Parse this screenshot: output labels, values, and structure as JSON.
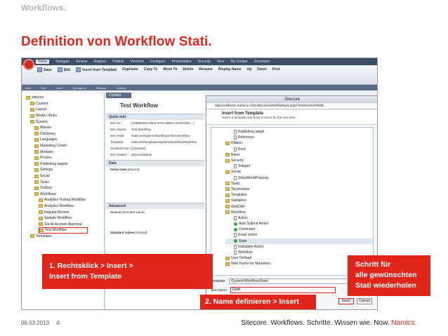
{
  "slide": {
    "header": "Workflows.",
    "title": "Definition von Workflow Stati.",
    "date": "06.03.2013",
    "page": "4",
    "footer_text": "Sitecore. Workflows. Schritte. Wissen wie. Now. ",
    "footer_brand": "Namics."
  },
  "callouts": {
    "step1_line1": "1. Rechtsklick > Insert >",
    "step1_line2": "Insert from Template",
    "step2": "2. Name definieren > Insert",
    "step3_line1": "Schritt für",
    "step3_line2": "alle gewünschten",
    "step3_line3": "Stati wiederholen"
  },
  "sitecore": {
    "tabs": [
      "Home",
      "Navigate",
      "Review",
      "Analyze",
      "Publish",
      "Versions",
      "Configure",
      "Presentation",
      "Security",
      "View",
      "My Toolbar",
      "Developer"
    ],
    "ribbon_buttons": [
      "Save",
      "Edit",
      "Insert from Template",
      "Duplicate",
      "Copy To",
      "Move To",
      "Delete",
      "Rename",
      "Display Name",
      "Up",
      "Down",
      "First"
    ],
    "ribbon_groups": [
      "Write",
      "Edit",
      "Insert",
      "Operations",
      "Rename",
      "Sorting"
    ],
    "tree": [
      "sitecore",
      "Content",
      "Layout",
      "Media Library",
      "System",
      "Aliases",
      "Dictionary",
      "Languages",
      "Marketing Center",
      "Modules",
      "Proxies",
      "Publishing targets",
      "Settings",
      "Social",
      "Tasks",
      "Toolbox",
      "Workflows",
      "Analytics Testing Workflow",
      "Analytics Workflow",
      "Regular Review",
      "Sample Workflow",
      "Social Account Approval",
      "Test Workflow",
      "Templates"
    ],
    "content_tab": "Content",
    "workflow_title": "Test Workflow",
    "quick_info": "Quick Info",
    "fields": [
      {
        "k": "Item ID:",
        "v": "{F0B8D2D0-8983-4F61-8BE3-CE84CD8C...}"
      },
      {
        "k": "Item Name:",
        "v": "Test Workflow"
      },
      {
        "k": "Item Path:",
        "v": "/sitecore/system/Workflows/Test Workflow"
      },
      {
        "k": "Template:",
        "v": "/sitecore/templates/System/Workflow/Workflow"
      },
      {
        "k": "Created From:",
        "v": "[unknown]"
      },
      {
        "k": "Item Owner:",
        "v": "sitecore\\admin"
      }
    ],
    "data_section": "Data",
    "initial_state": "Initial state",
    "initial_state_hint": "[shared]:",
    "advanced_section": "Advanced",
    "source": "Source",
    "source_hint": "[standard value]:",
    "standard_values": "Standard values",
    "standard_values_hint": "[shared]:"
  },
  "dialog": {
    "window_title": "Sitecore",
    "url": "sitecoredemo.namics.com/sitecore/shell/default.aspx?xmlcontrol=Add...",
    "heading": "Insert from Template",
    "subheading": "Select a template and enter a name for the new item.",
    "tree": [
      "Publishing target",
      "Reference",
      "Ribbon",
      "Root",
      "Rules",
      "Security",
      "Snippet",
      "Social",
      "ShopWorldProperty",
      "Tasks",
      "Taxonomies",
      "Templates",
      "Validation",
      "WebDAV",
      "Workflow",
      "Action",
      "Auto Submit Action",
      "Command",
      "Email action",
      "State",
      "Validation Action",
      "Workflow",
      "User Defined",
      "Web Forms for Marketers"
    ],
    "template_label": "Template:",
    "template_value": "/System/Workflow/State",
    "name_label": "Item Name:",
    "name_value": "Draft",
    "insert_label": "Insert",
    "cancel_label": "Cancel"
  }
}
